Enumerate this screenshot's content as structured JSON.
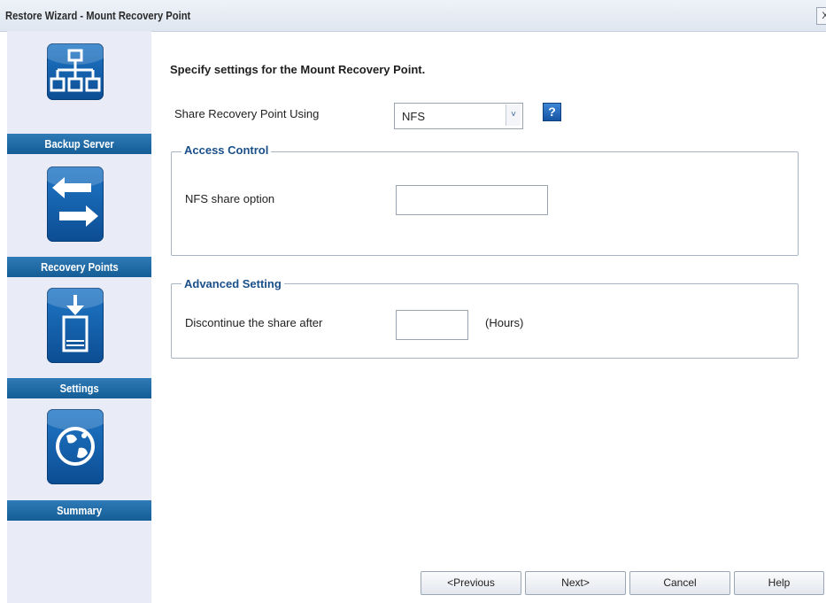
{
  "window": {
    "title": "Restore Wizard - Mount Recovery Point",
    "close_glyph": "X"
  },
  "sidebar": {
    "steps": [
      {
        "label": "Backup Server",
        "icon": "backup-server-icon"
      },
      {
        "label": "Recovery Points",
        "icon": "recovery-points-icon"
      },
      {
        "label": "Settings",
        "icon": "settings-icon"
      },
      {
        "label": "Summary",
        "icon": "summary-icon"
      }
    ]
  },
  "main": {
    "heading": "Specify settings for the Mount Recovery Point.",
    "share_using": {
      "label": "Share Recovery Point Using",
      "selected": "NFS",
      "arrow": "˅"
    },
    "help_glyph": "?",
    "access_control": {
      "legend": "Access Control",
      "nfs_option_label": "NFS share option",
      "nfs_option_value": ""
    },
    "advanced": {
      "legend": "Advanced Setting",
      "discontinue_label": "Discontinue the share after",
      "hours_value": "",
      "unit": "(Hours)"
    }
  },
  "footer": {
    "previous": "<Previous",
    "next": "Next>",
    "cancel": "Cancel",
    "help": "Help"
  },
  "colors": {
    "sidebar_bg": "#e9ecf7",
    "step_label_bg": "#145d96",
    "legend_text": "#1a4f8a",
    "icon_blue": "#0c4d93"
  }
}
